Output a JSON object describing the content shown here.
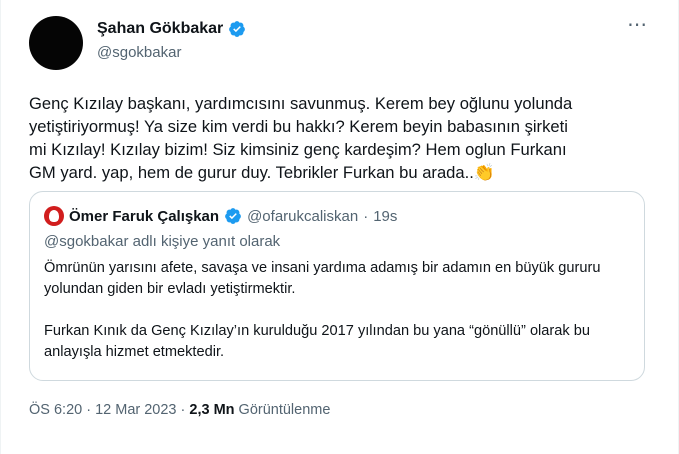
{
  "author": {
    "display_name": "Şahan Gökbakar",
    "handle": "@sgokbakar",
    "verified": true
  },
  "more_icon": "⋯",
  "tweet": {
    "line1": "Genç Kızılay başkanı, yardımcısını savunmuş. Kerem bey oğlunu yolunda",
    "line2": "yetiştiriyormuş! Ya size kim verdi bu hakkı? Kerem beyin babasının şirketi",
    "line3": "mi Kızılay! Kızılay bizim! Siz kimsiniz genç kardeşim? Hem oglun Furkanı",
    "line4": "GM yard. yap, hem de gurur duy. Tebrikler Furkan bu arada..",
    "emoji": "👏"
  },
  "quote": {
    "display_name": "Ömer Faruk Çalışkan",
    "handle": "@ofarukcaliskan",
    "separator": "·",
    "time": "19s",
    "verified": true,
    "reply_to": "@sgokbakar adlı kişiye yanıt olarak",
    "para1": "Ömrünün yarısını afete, savaşa ve insani yardıma adamış bir adamın en büyük gururu yolundan giden bir evladı yetiştirmektir.",
    "para2": "Furkan Kınık da Genç Kızılay’ın kurulduğu 2017 yılından bu yana “gönüllü” olarak bu anlayışla hizmet etmektedir."
  },
  "meta": {
    "timestamp": "ÖS 6:20 · 12 Mar 2023",
    "dot": " · ",
    "views_count": "2,3 Mn",
    "views_label": " Görüntülenme"
  },
  "colors": {
    "verified_blue": "#1d9bf0",
    "muted": "#536471",
    "border": "#cfd9de"
  }
}
